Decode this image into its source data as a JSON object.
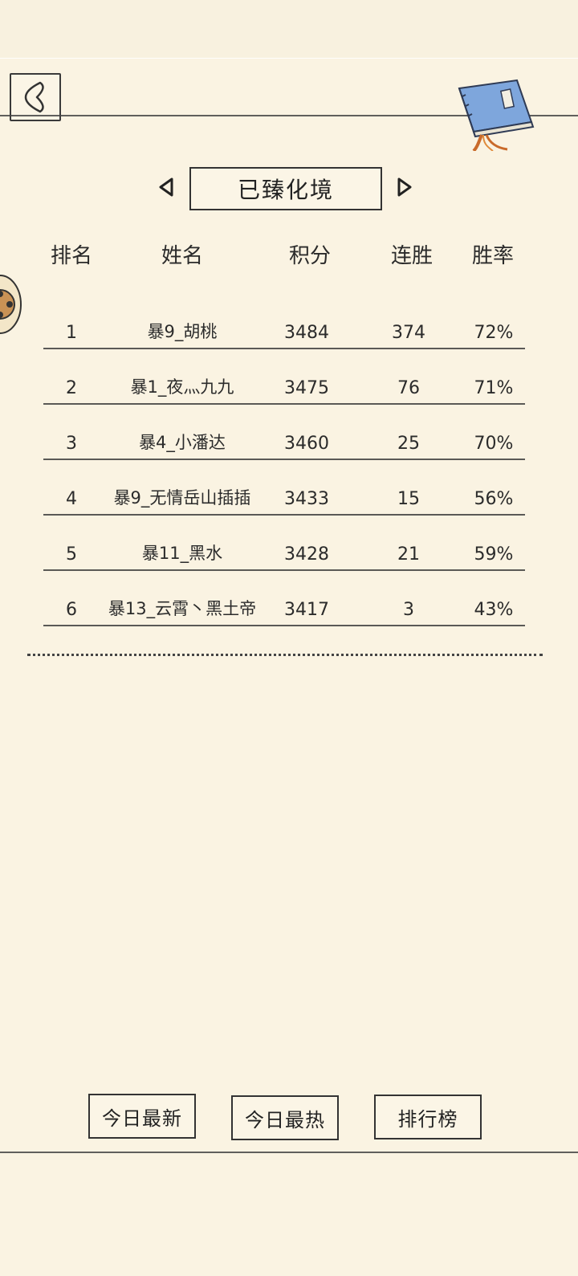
{
  "header": {
    "back_icon": "back-chevron-icon",
    "book_icon": "book-icon"
  },
  "selector": {
    "title": "已臻化境",
    "prev_icon": "triangle-left-icon",
    "next_icon": "triangle-right-icon"
  },
  "table": {
    "columns": [
      "排名",
      "姓名",
      "积分",
      "连胜",
      "胜率"
    ],
    "rows": [
      {
        "rank": "1",
        "name": "暴9_胡桃",
        "score": "3484",
        "streak": "374",
        "rate": "72%"
      },
      {
        "rank": "2",
        "name": "暴1_夜灬九九",
        "score": "3475",
        "streak": "76",
        "rate": "71%"
      },
      {
        "rank": "3",
        "name": "暴4_小潘达",
        "score": "3460",
        "streak": "25",
        "rate": "70%"
      },
      {
        "rank": "4",
        "name": "暴9_无情岳山插插",
        "score": "3433",
        "streak": "15",
        "rate": "56%"
      },
      {
        "rank": "5",
        "name": "暴11_黑水",
        "score": "3428",
        "streak": "21",
        "rate": "59%"
      },
      {
        "rank": "6",
        "name": "暴13_云霄丶黑土帝",
        "score": "3417",
        "streak": "3",
        "rate": "43%"
      }
    ]
  },
  "bottom_nav": {
    "today_new": "今日最新",
    "today_hot": "今日最热",
    "leaderboard": "排行榜"
  }
}
